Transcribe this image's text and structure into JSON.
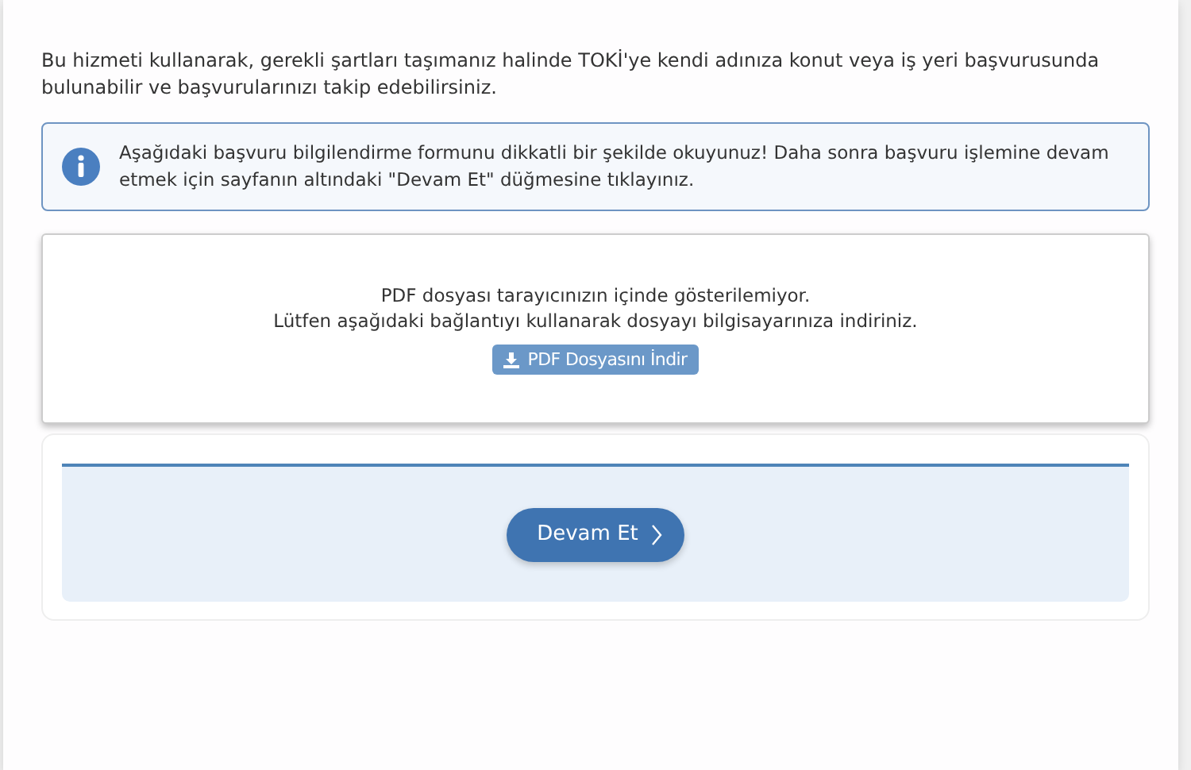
{
  "intro": "Bu hizmeti kullanarak, gerekli şartları taşımanız halinde TOKİ'ye kendi adınıza konut veya iş yeri başvurusunda bulunabilir ve başvurularınızı takip edebilirsiniz.",
  "alert": {
    "text": "Aşağıdaki başvuru bilgilendirme formunu dikkatli bir şekilde okuyunuz! Daha sonra başvuru işlemine devam etmek için sayfanın altındaki \"Devam Et\" düğmesine tıklayınız."
  },
  "pdf_viewer": {
    "message_lines": [
      "PDF dosyası tarayıcınızın içinde gösterilemiyor.",
      "Lütfen aşağıdaki bağlantıyı kullanarak dosyayı bilgisayarınıza indiriniz."
    ],
    "download_button": "PDF Dosyasını İndir"
  },
  "continue_button": "Devam Et"
}
